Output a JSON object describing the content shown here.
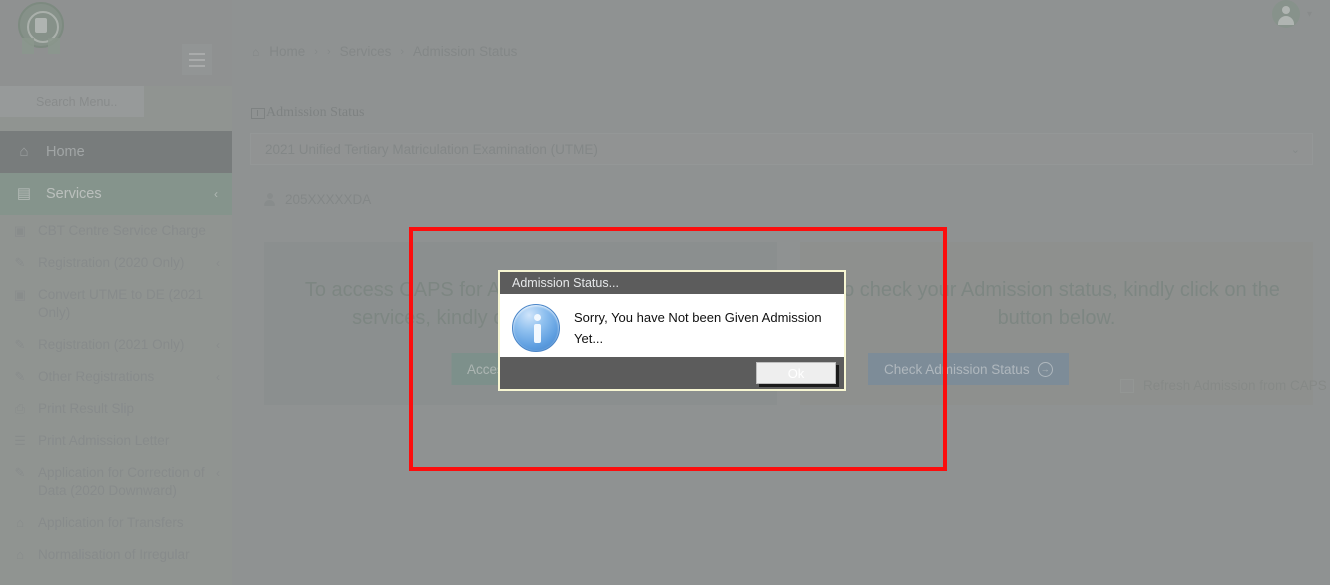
{
  "app": {
    "logo_alt": "jamb-seal-logo"
  },
  "sidebar": {
    "search_placeholder": "Search Menu..",
    "items": [
      {
        "label": "Home",
        "icon": "home-icon",
        "caret": "",
        "state": "home"
      },
      {
        "label": "Services",
        "icon": "services-icon",
        "caret": "‹",
        "state": "active"
      },
      {
        "label": "CBT Centre Service Charge",
        "icon": "money-icon",
        "caret": ""
      },
      {
        "label": "Registration (2020 Only)",
        "icon": "edit-icon",
        "caret": "‹"
      },
      {
        "label": "Convert UTME to DE (2021 Only)",
        "icon": "money-icon",
        "caret": ""
      },
      {
        "label": "Registration (2021 Only)",
        "icon": "edit-icon",
        "caret": "‹"
      },
      {
        "label": "Other Registrations",
        "icon": "edit-icon",
        "caret": "‹"
      },
      {
        "label": "Print Result Slip",
        "icon": "printer-icon",
        "caret": ""
      },
      {
        "label": "Print Admission Letter",
        "icon": "document-icon",
        "caret": ""
      },
      {
        "label": "Application for Correction of Data (2020 Downward)",
        "icon": "edit-filled-icon",
        "caret": "‹"
      },
      {
        "label": "Application for Transfers",
        "icon": "bank-icon",
        "caret": ""
      },
      {
        "label": "Normalisation of Irregular",
        "icon": "bank-icon",
        "caret": ""
      }
    ]
  },
  "topbar": {
    "avatar": "user-avatar-icon",
    "caret": "▾"
  },
  "breadcrumb": {
    "home": "Home",
    "sep": "›",
    "services": "Services",
    "current": "Admission Status"
  },
  "panel": {
    "title": "Admission Status"
  },
  "form": {
    "exam_select_value": "2021 Unified Tertiary Matriculation Examination (UTME)",
    "exam_select_caret": "⌄",
    "regno_value": "205XXXXXDA"
  },
  "cards": {
    "left": {
      "text": "To access CAPS for Admission and other related services, kindly click the button below.",
      "button_label": "Access CAPS",
      "button_arrow": "→"
    },
    "right": {
      "text": "To check your Admission status, kindly click on the button below.",
      "button_label": "Check Admission Status",
      "button_arrow": "→",
      "checkbox_label": "Refresh Admission from CAPS",
      "checkbox_checked": "false"
    }
  },
  "modal": {
    "title": "Admission Status...",
    "icon": "info-icon",
    "message": "Sorry, You have Not been Given Admission Yet...",
    "ok_label": "Ok"
  },
  "annotation": {
    "type": "red-rectangle-highlight",
    "color": "#fc0d0d"
  },
  "colors": {
    "sidebar_bg": "#9ba09c",
    "sidebar_active": "#8aa093",
    "sidebar_home": "#74797a",
    "content_bg": "#9a9d9d",
    "card_left_button": "#7d9a92",
    "card_right_button": "#7c93a6",
    "modal_titlebar": "#5c5c5c",
    "modal_border": "#f7f6d2",
    "annotation_red": "#fc0d0d"
  }
}
